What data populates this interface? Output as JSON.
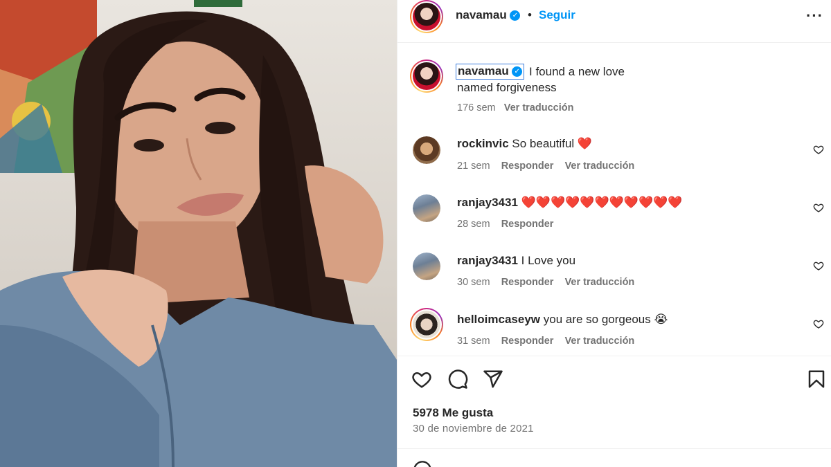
{
  "post": {
    "username": "navamau",
    "verified_mark": "✓",
    "separator": "•",
    "follow_label": "Seguir",
    "more_label": "···"
  },
  "caption": {
    "username": "navamau",
    "text_line1": "I found a new love",
    "text_line2": "named forgiveness",
    "age": "176 sem",
    "translate_label": "Ver traducción"
  },
  "comments": [
    {
      "username": "rockinvic",
      "text": "So beautiful ❤️",
      "age": "21 sem",
      "reply_label": "Responder",
      "translate_label": "Ver traducción"
    },
    {
      "username": "ranjay3431",
      "text": "❤️❤️❤️❤️❤️❤️❤️❤️❤️❤️❤️",
      "age": "28 sem",
      "reply_label": "Responder"
    },
    {
      "username": "ranjay3431",
      "text": "I Love you",
      "age": "30 sem",
      "reply_label": "Responder",
      "translate_label": "Ver traducción"
    },
    {
      "username": "helloimcaseyw",
      "text": "you are so gorgeous 😭",
      "age": "31 sem",
      "reply_label": "Responder",
      "translate_label": "Ver traducción"
    }
  ],
  "actions": {
    "icons": [
      "heart-icon",
      "comment-icon",
      "share-icon",
      "bookmark-icon"
    ],
    "likes": "5978 Me gusta",
    "date": "30 de noviembre de 2021"
  },
  "colors": {
    "accent": "#0095f6",
    "text": "#262626",
    "muted": "#737373",
    "divider": "#efefef"
  }
}
